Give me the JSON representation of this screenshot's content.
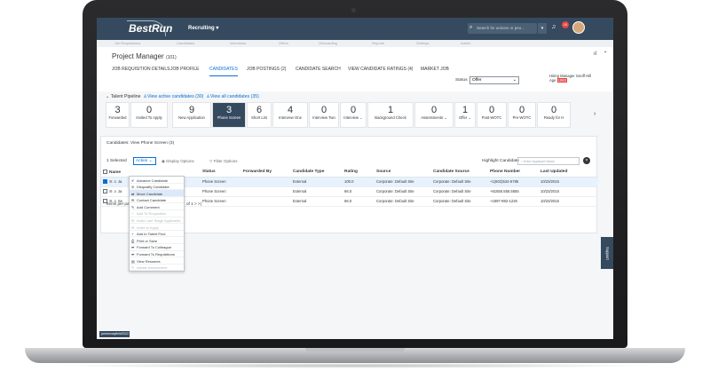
{
  "shell": {
    "brand": "BestRun",
    "module": "Recruiting ▾",
    "search_placeholder": "Search for actions or peo...",
    "notification_count": "10"
  },
  "subnav": [
    "Job Requisitions",
    "Candidates",
    "Interviews",
    "Offers",
    "Onboarding",
    "Reports",
    "Settings",
    "Admin"
  ],
  "header": {
    "title": "Project Manager",
    "req_id": "(101)",
    "tabs": [
      "JOB REQUISITION DETAILS",
      "JOB PROFILE",
      "CANDIDATES",
      "JOB POSTINGS (2)",
      "CANDIDATE SEARCH",
      "VIEW CANDIDATE RATINGS (4)",
      "MARKET JOB"
    ],
    "active_tab": "CANDIDATES",
    "status_label": "Status",
    "status_value": "Offer",
    "hiring_manager_label": "Hiring Manager",
    "hiring_manager_value": "Geoff Hill",
    "age_label": "Age",
    "age_value": "1083"
  },
  "pipeline": {
    "title": "Talent Pipeline",
    "link_active": "View active candidates (30)",
    "link_all": "View all candidates (35)",
    "stages": [
      {
        "count": "3",
        "label": "Forwarded",
        "active": false
      },
      {
        "count": "0",
        "label": "Invited To Apply",
        "active": false
      },
      {
        "count": "9",
        "label": "New Application",
        "active": false
      },
      {
        "count": "3",
        "label": "Phone Screen",
        "active": true
      },
      {
        "count": "6",
        "label": "Short List",
        "active": false
      },
      {
        "count": "4",
        "label": "Interview One",
        "active": false
      },
      {
        "count": "0",
        "label": "Interview Two",
        "active": false
      },
      {
        "count": "0",
        "label": "Interview ⌄",
        "active": false
      },
      {
        "count": "1",
        "label": "Background Check",
        "active": false
      },
      {
        "count": "0",
        "label": "Assessments ⌄",
        "active": false
      },
      {
        "count": "1",
        "label": "Offer ⌄",
        "active": false
      },
      {
        "count": "0",
        "label": "Post-WOTC",
        "active": false
      },
      {
        "count": "0",
        "label": "Pre-WOTC",
        "active": false
      },
      {
        "count": "0",
        "label": "Ready for H",
        "active": false
      }
    ]
  },
  "panel": {
    "title": "Candidates: View Phone Screen (3)",
    "selected": "1 Selected",
    "action_label": "Action ⌄",
    "display_options": "Display Options",
    "filter_options": "Filter Options",
    "highlight_label": "Highlight Candidate",
    "highlight_placeholder": "Enter Applicant Name",
    "columns": [
      "Name",
      "Status",
      "Forwarded By",
      "Candidate Type",
      "Rating",
      "Source",
      "Candidate Source",
      "Phone Number",
      "Last Updated"
    ],
    "rows": [
      {
        "name": "Ja",
        "status": "Phone Screen",
        "forwarded_by": "",
        "type": "External",
        "rating": "100.0",
        "source": "Corporate: Default Site",
        "candidate_source": "Corporate: Default Site",
        "phone": "+1(602)534-5785",
        "updated": "10/23/2015",
        "checked": true
      },
      {
        "name": "Ja",
        "status": "Phone Screen",
        "forwarded_by": "",
        "type": "External",
        "rating": "66.0",
        "source": "Corporate: Default Site",
        "candidate_source": "Corporate: Default Site",
        "phone": "+61555.555.5555",
        "updated": "10/23/2015",
        "checked": false
      },
      {
        "name": "Se",
        "status": "Phone Screen",
        "forwarded_by": "",
        "type": "External",
        "rating": "66.0",
        "source": "Corporate: Default Site",
        "candidate_source": "Corporate: Default Site",
        "phone": "+1897-982-1226",
        "updated": "10/23/2015",
        "checked": false
      }
    ],
    "pager_left": "Items per page",
    "pager_right": "of 1  >  >|"
  },
  "action_menu": [
    {
      "label": "Advance Candidate",
      "icon": "✔",
      "disabled": false,
      "hover": false
    },
    {
      "label": "Disqualify Candidate",
      "icon": "⊘",
      "disabled": false,
      "hover": false
    },
    {
      "label": "Move Candidate",
      "icon": "⇄",
      "disabled": false,
      "hover": true
    },
    {
      "label": "Contact Candidate",
      "icon": "✉",
      "disabled": false,
      "hover": false
    },
    {
      "label": "Add Comment",
      "icon": "✎",
      "disabled": false,
      "hover": false
    },
    {
      "label": "Add To Requisition",
      "icon": "+",
      "disabled": true,
      "hover": false
    },
    {
      "label": "Invite Late Stage Applicants",
      "icon": "✉",
      "disabled": true,
      "hover": false
    },
    {
      "label": "Invite to Apply",
      "icon": "✉",
      "disabled": true,
      "hover": false
    },
    {
      "label": "Add to Talent Pool",
      "icon": "+",
      "disabled": false,
      "hover": false
    },
    {
      "label": "Print or Save",
      "icon": "⎙",
      "disabled": false,
      "hover": false
    },
    {
      "label": "Forward To Colleague",
      "icon": "➦",
      "disabled": false,
      "hover": false
    },
    {
      "label": "Forward To Requisitions",
      "icon": "➦",
      "disabled": false,
      "hover": false
    },
    {
      "label": "View Resumes",
      "icon": "▤",
      "disabled": false,
      "hover": false
    },
    {
      "label": "Initiate Assessment",
      "icon": "✎",
      "disabled": true,
      "hover": false
    }
  ],
  "support_label": "Support",
  "footer_id": "jamesmayfield2022"
}
